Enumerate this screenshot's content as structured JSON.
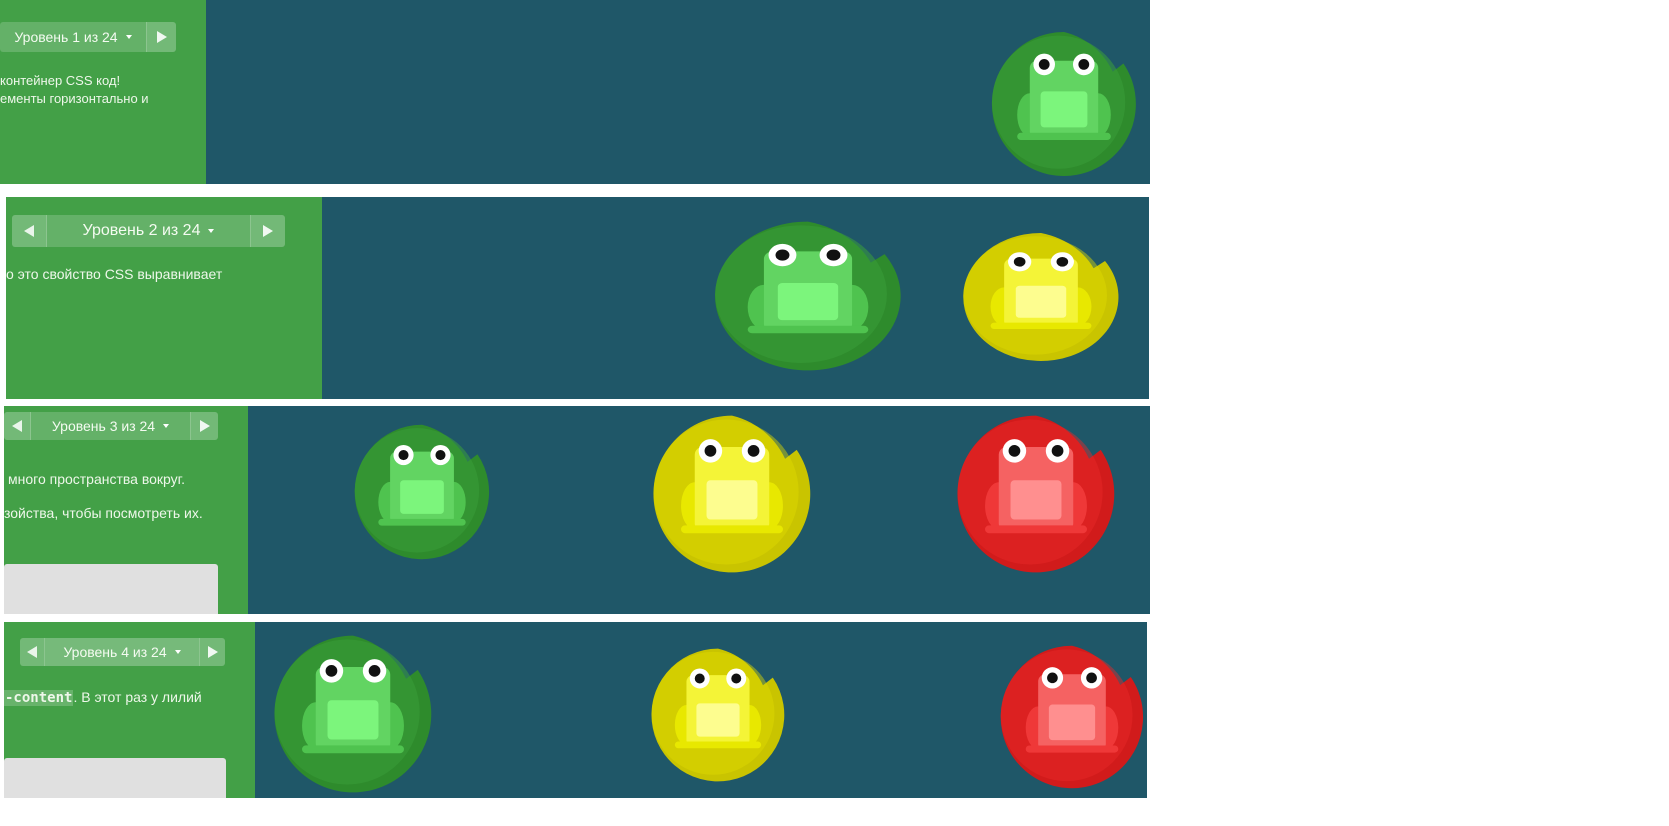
{
  "levels": [
    {
      "nav": {
        "label": "Уровень 1 из 24"
      },
      "lines": [
        "контейнер CSS код!",
        "ементы горизонтально и"
      ]
    },
    {
      "nav": {
        "label": "Уровень 2 из 24"
      },
      "lines": [
        "о это свойство CSS выравнивает"
      ]
    },
    {
      "nav": {
        "label": "Уровень 3 из 24"
      },
      "lines": [
        "много пространства вокруг.",
        "зойства, чтобы посмотреть их."
      ]
    },
    {
      "nav": {
        "label": "Уровень 4 из 24"
      },
      "code": "-content",
      "after": ". В этот раз у лилий"
    }
  ],
  "colors": {
    "sidebar": "#43a047",
    "pond": "#1f5768",
    "green_pad": "#2e8b2c",
    "yellow_pad": "#c9c400",
    "red_pad": "#d11b1b"
  },
  "icons": [
    "nav-prev-icon",
    "nav-next-icon",
    "level-dropdown-caret-icon",
    "frog-icon",
    "lilypad-icon"
  ]
}
